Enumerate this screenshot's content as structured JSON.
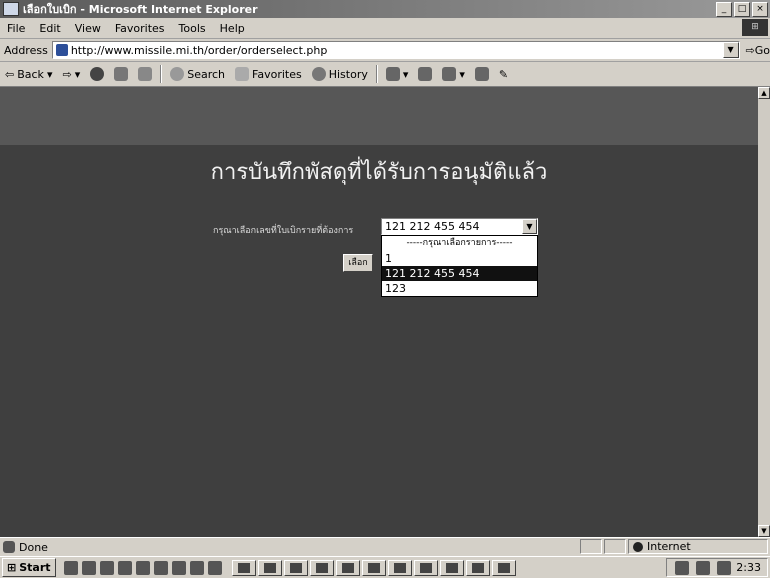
{
  "window": {
    "title": "เลือกใบเบิก - Microsoft Internet Explorer",
    "controls": [
      "_",
      "□",
      "×"
    ]
  },
  "menu": [
    "File",
    "Edit",
    "View",
    "Favorites",
    "Tools",
    "Help"
  ],
  "address": {
    "label": "Address",
    "url": "http://www.missile.mi.th/order/orderselect.php",
    "go_label": "Go"
  },
  "toolbar": {
    "back": "Back",
    "search": "Search",
    "favorites": "Favorites",
    "history": "History"
  },
  "page": {
    "title": "การบันทึกพัสดุที่ได้รับการอนุมัติแล้ว",
    "select_label": "กรุณาเลือกเลขที่ใบเบิกรายที่ต้องการ",
    "selected_value": "121 212 455 454",
    "options": [
      "-----กรุณาเลือกรายการ-----",
      "1",
      "121 212 455 454",
      "123"
    ],
    "submit_label": "เลือก"
  },
  "status": {
    "text": "Done",
    "zone": "Internet"
  },
  "taskbar": {
    "start": "Start",
    "clock": "2:33"
  }
}
